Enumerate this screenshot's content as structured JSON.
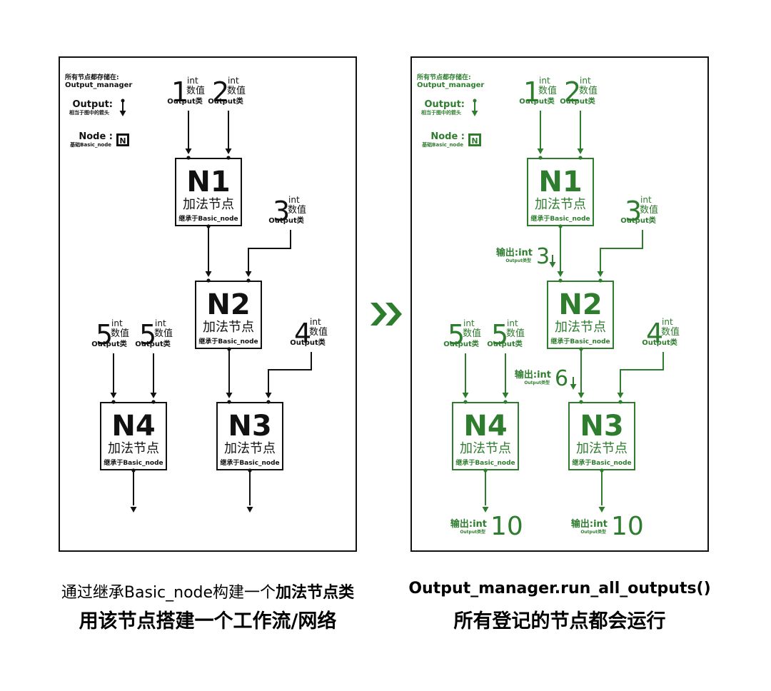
{
  "colors": {
    "black": "#111111",
    "green": "#2e7d2e",
    "white": "#ffffff"
  },
  "legend": {
    "storage_line1": "所有节点都存储在:",
    "storage_line2": "Output_manager",
    "output_title": "Output:",
    "output_desc": "相当于图中的箭头",
    "node_title": "Node :",
    "node_desc": "基础Basic_node",
    "node_icon_letter": "N"
  },
  "input_labels": {
    "type": "int",
    "value_word": "数值",
    "output_word": "Output类"
  },
  "inputs": [
    {
      "id": "in1",
      "num": "1"
    },
    {
      "id": "in2",
      "num": "2"
    },
    {
      "id": "in3",
      "num": "3"
    },
    {
      "id": "in4",
      "num": "4"
    },
    {
      "id": "in5a",
      "num": "5"
    },
    {
      "id": "in5b",
      "num": "5"
    }
  ],
  "node_labels": {
    "kind": "加法节点",
    "inherit": "继承于Basic_node"
  },
  "nodes": [
    {
      "id": "N1",
      "title": "N1"
    },
    {
      "id": "N2",
      "title": "N2"
    },
    {
      "id": "N3",
      "title": "N3"
    },
    {
      "id": "N4",
      "title": "N4"
    }
  ],
  "outputs_right": {
    "prefix": "输出:int",
    "sub": "Output类型",
    "n1_value": "3",
    "n2_value": "6",
    "n3_value": "10",
    "n4_value": "10"
  },
  "transition_icon": "double-chevron-right-icon",
  "captions": {
    "left_line1_plain": "通过继承Basic_node构建一个",
    "left_line1_bold": "加法节点类",
    "left_line2": "用该节点搭建一个工作流/网络",
    "right_line1": "Output_manager.run_all_outputs()",
    "right_line2": "所有登记的节点都会运行"
  }
}
